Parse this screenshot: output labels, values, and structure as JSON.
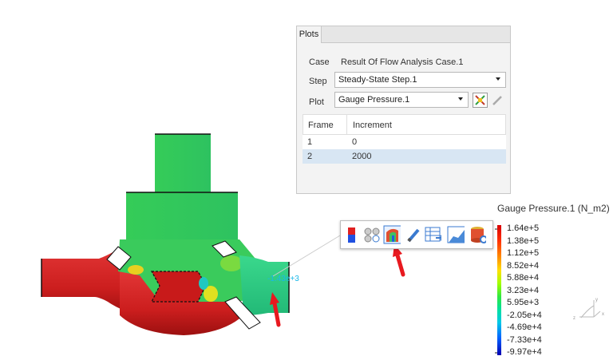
{
  "plots_panel": {
    "tab_label": "Plots",
    "case_label": "Case",
    "case_value": "Result Of Flow Analysis Case.1",
    "step_label": "Step",
    "step_value": "Steady-State Step.1",
    "plot_label": "Plot",
    "plot_value": "Gauge Pressure.1",
    "table": {
      "headers": [
        "Frame",
        "Increment"
      ],
      "rows": [
        {
          "frame": "1",
          "increment": "0"
        },
        {
          "frame": "2",
          "increment": "2000"
        }
      ],
      "selected_row": 2
    }
  },
  "toolbar": {
    "icons": [
      "color-bar-icon",
      "point-cloud-icon",
      "surface-plot-icon",
      "edit-pencil-icon",
      "table-export-icon",
      "chart-icon",
      "settings-cylinder-icon"
    ],
    "highlighted": "surface-plot-icon"
  },
  "probe_label": "-1.43e+3",
  "legend": {
    "title": "Gauge Pressure.1 (N_m2)",
    "labels": [
      "1.64e+5",
      "1.38e+5",
      "1.12e+5",
      "8.52e+4",
      "5.88e+4",
      "3.23e+4",
      "5.95e+3",
      "-2.05e+4",
      "-4.69e+4",
      "-7.33e+4",
      "-9.97e+4"
    ],
    "colors": [
      "#e00000",
      "#ff3a00",
      "#ff9000",
      "#ffd000",
      "#c8ff00",
      "#60ff20",
      "#00e060",
      "#00e0c0",
      "#00a0ff",
      "#0040ff",
      "#0000c0"
    ]
  },
  "axis_triad_labels": [
    "y",
    "z",
    "x"
  ],
  "colors": {
    "accent_arrow": "#e8191f",
    "selected_row": "#d8e6f3",
    "mesh_high": "#d41f1f",
    "mesh_mid": "#2ed158"
  }
}
